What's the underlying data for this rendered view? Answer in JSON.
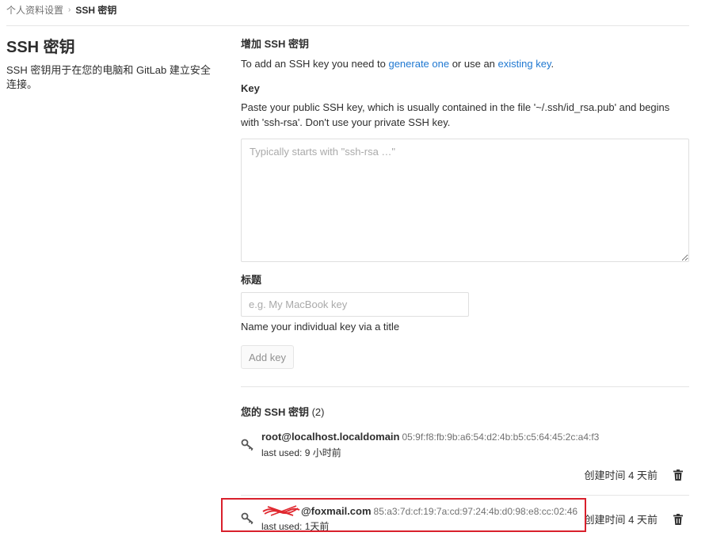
{
  "breadcrumb": {
    "parent": "个人资料设置",
    "separator": "›",
    "current": "SSH 密钥"
  },
  "sidebar": {
    "title": "SSH 密钥",
    "description": "SSH 密钥用于在您的电脑和 GitLab 建立安全连接。"
  },
  "add_form": {
    "heading": "增加 SSH 密钥",
    "intro_prefix": "To add an SSH key you need to ",
    "generate_link": "generate one",
    "intro_middle": " or use an ",
    "existing_link": "existing key",
    "intro_suffix": ".",
    "key_label": "Key",
    "key_help": "Paste your public SSH key, which is usually contained in the file '~/.ssh/id_rsa.pub' and begins with 'ssh-rsa'. Don't use your private SSH key.",
    "key_placeholder": "Typically starts with \"ssh-rsa …\"",
    "title_label": "标题",
    "title_placeholder": "e.g. My MacBook key",
    "title_help": "Name your individual key via a title",
    "add_button": "Add key"
  },
  "keys": {
    "heading": "您的 SSH 密钥",
    "count": "(2)",
    "items": [
      {
        "title": "root@localhost.localdomain",
        "fingerprint": "05:9f:f8:fb:9b:a6:54:d2:4b:b5:c5:64:45:2c:a4:f3",
        "last_used": "last used: 9 小时前",
        "created": "创建时间 4 天前"
      },
      {
        "title": "@foxmail.com",
        "fingerprint": "85:a3:7d:cf:19:7a:cd:97:24:4b:d0:98:e8:cc:02:46",
        "last_used": "last used: 1天前",
        "created": "创建时间 4 天前"
      }
    ]
  },
  "colors": {
    "link": "#1f78d1",
    "highlight": "#d9202c",
    "redaction": "#e0282f"
  }
}
